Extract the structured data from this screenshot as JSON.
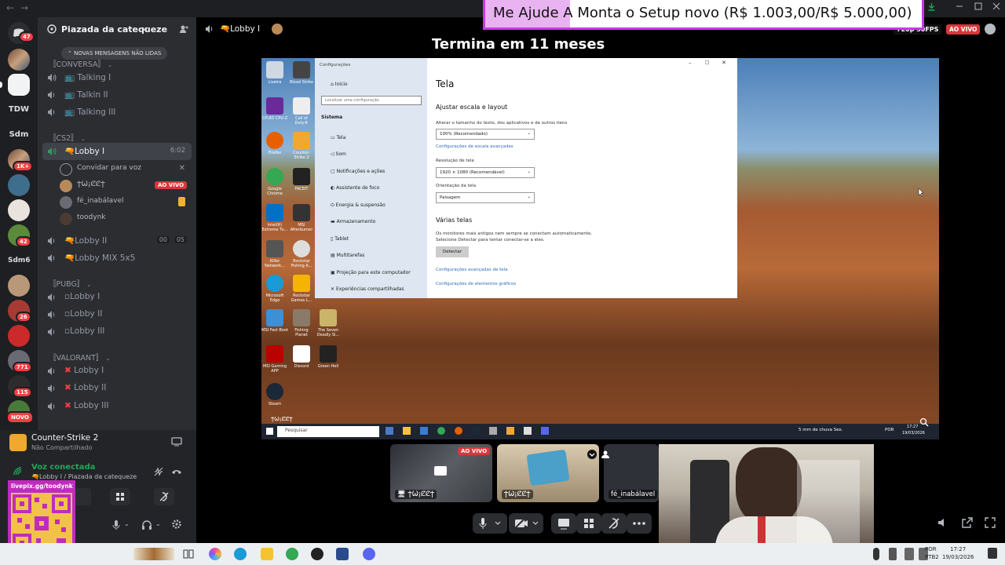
{
  "window": {
    "back_arrow": "←",
    "forward_arrow": "→"
  },
  "server": {
    "name": "Piazada da catequeze",
    "unread_pill": "NOVAS MENSAGENS NÃO LIDAS"
  },
  "rail": {
    "badges": [
      "47",
      "1K+",
      "42",
      "26",
      "771",
      "115"
    ],
    "text_servers": [
      "TDW",
      "Sdm",
      "Sdm6_"
    ],
    "new_label": "NOVO"
  },
  "categories": [
    {
      "label": "〚CONVERSA〛",
      "channels": [
        "Talking I",
        "Talkin II",
        "Talking III"
      ]
    },
    {
      "label": "〚CS2〛",
      "channels": [
        "Lobby I",
        "Lobby II",
        "Lobby MIX 5x5"
      ]
    },
    {
      "label": "〚PUBG〛",
      "channels": [
        "Lobby I",
        "Lobby II",
        "Lobby III"
      ]
    },
    {
      "label": "〚VALORANT〛",
      "channels": [
        "Lobby I",
        "Lobby II",
        "Lobby III"
      ]
    }
  ],
  "active_channel": {
    "timer": "6:02",
    "invite_label": "Convidar para voz",
    "members": [
      {
        "name": "ϮѠ¡ȻȻϮ",
        "live": "AO VIVO"
      },
      {
        "name": "fé_inabálavel"
      },
      {
        "name": "toodynk"
      }
    ],
    "lobby2_counts": [
      "00",
      "05"
    ]
  },
  "activity": {
    "game": "Counter-Strike 2",
    "status": "Não Compartilhado"
  },
  "voice": {
    "status": "Voz conectada",
    "location": "Lobby I / Piazada da catequeze"
  },
  "overlay": {
    "link": "livepix.gg/toodynk"
  },
  "stream": {
    "channel": "Lobby I",
    "banner_left": "Me Ajude A",
    "banner_right": "Monta o Setup novo (R$ 1.003,00/R$ 5.000,00)",
    "countdown": "Termina em 11 meses",
    "quality": "720p 30FPS",
    "live": "AO VIVO"
  },
  "settings_window": {
    "title": "Configurações",
    "home": "Início",
    "search_placeholder": "Localizar uma configuração",
    "section": "Sistema",
    "side_items": [
      "Tela",
      "Som",
      "Notificações e ações",
      "Assistente de foco",
      "Energia & suspensão",
      "Armazenamento",
      "Tablet",
      "Multitarefas",
      "Projeção para este computador",
      "Experiências compartilhadas"
    ],
    "heading": "Tela",
    "scale_heading": "Ajustar escala e layout",
    "scale_desc": "Alterar o tamanho do texto, dos aplicativos e de outros itens",
    "scale_value": "100% (Recomendado)",
    "scale_link": "Configurações de escala avançadas",
    "resolution_label": "Resolução de tela",
    "resolution_value": "1920 × 1080 (Recomendável)",
    "orientation_label": "Orientação da tela",
    "orientation_value": "Paisagem",
    "multi_heading": "Várias telas",
    "multi_desc1": "Os monitores mais antigos nem sempre se conectam automaticamente.",
    "multi_desc2": "Selecione Detectar para tentar conectar-se a eles.",
    "detect_button": "Detectar",
    "advanced_link": "Configurações avançadas de tela",
    "graphics_link": "Configurações de elementos gráficos"
  },
  "desktop_icons": [
    "Lixeira",
    "Blood Strike",
    "CPUID CPU-Z",
    "Call of Duty®",
    "Firefox",
    "Counter-Strike 2",
    "Google Chrome",
    "FACEIT",
    "Intel(R) Extreme Tu...",
    "MSI Afterburner",
    "Killer Network...",
    "Rockstar Fishing A...",
    "Microsoft Edge",
    "Rockstar Games L...",
    "MSI Fast Boot",
    "Fishing Planet",
    "The Seven Deadly Si...",
    "MSI Gaming APP",
    "Discord",
    "Green Hell",
    "Steam"
  ],
  "inner_taskbar": {
    "search": "Pesquisar",
    "weather": "5 mm de chuva Sex.",
    "lang": "POR",
    "time": "17:27",
    "date": "19/03/2026",
    "stream_owner": "ϮѠ¡ȻȻϮ"
  },
  "thumbnails": [
    {
      "name": "ϮѠ¡ȻȻϮ",
      "live": "AO VIVO"
    },
    {
      "name": "ϮѠ¡ȻȻϮ"
    },
    {
      "name": "fé_inabálavel"
    }
  ],
  "win_taskbar": {
    "lang1": "POR",
    "lang2": "PTB2",
    "time": "17:27",
    "date": "19/03/2026"
  },
  "colors": {
    "live_red": "#da373c",
    "voice_green": "#23a559",
    "discord_blurple": "#5865f2",
    "banner_border": "#c33de0"
  }
}
